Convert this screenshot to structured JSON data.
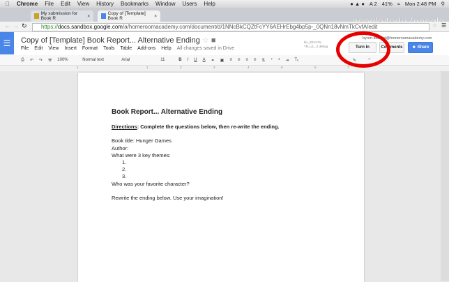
{
  "mac_menu": {
    "apple": "",
    "items": [
      "Chrome",
      "File",
      "Edit",
      "View",
      "History",
      "Bookmarks",
      "Window",
      "Users",
      "Help"
    ],
    "right": [
      "A 2",
      "41%",
      "Mon 2:48 PM"
    ]
  },
  "tabs": [
    {
      "label": "My submission for Book R"
    },
    {
      "label": "Copy of [Template] Book R"
    }
  ],
  "watermark": "google4edu (google",
  "address": {
    "scheme": "https://",
    "host": "docs.sandbox.google.com",
    "path": "/a/homeroomacademy.com/document/d/1NNcBkCQZtFcYY6AEHrEbg4bp5p-_0QNn18vNmTkCvfA/edit"
  },
  "doc_header": {
    "title": "Copy of [Template] Book Report... Alternative Ending",
    "menus": [
      "File",
      "Edit",
      "View",
      "Insert",
      "Format",
      "Tools",
      "Table",
      "Add-ons",
      "Help"
    ],
    "saved": "All changes saved in Drive",
    "revision": "kix_2014.31-Thu_d__2 debug",
    "user": "byron-student@homeroomacademy.com",
    "turn_in": "Turn In",
    "comments": "Comments",
    "share": "Share"
  },
  "toolbar": {
    "zoom": "100%",
    "style": "Normal text",
    "font": "Arial",
    "size": "11",
    "bold": "B",
    "italic": "I",
    "underline": "U",
    "color": "A"
  },
  "ruler": [
    "1",
    "1",
    "2",
    "3",
    "4",
    "5",
    "6",
    "7"
  ],
  "document": {
    "heading": "Book Report... Alternative Ending",
    "directions_label": "Directions",
    "directions_text": ": Complete the questions below, then re-write the ending.",
    "lines": [
      "Book title: Hunger Games",
      "Author:",
      "What were 3 key themes:"
    ],
    "list": [
      "1.",
      "2.",
      "3."
    ],
    "question": "Who was your favorite character?",
    "prompt": "Rewrite the ending below. Use your imagination!"
  },
  "colors": {
    "docs_blue": "#4a86e8",
    "annotation_red": "#e60000"
  }
}
